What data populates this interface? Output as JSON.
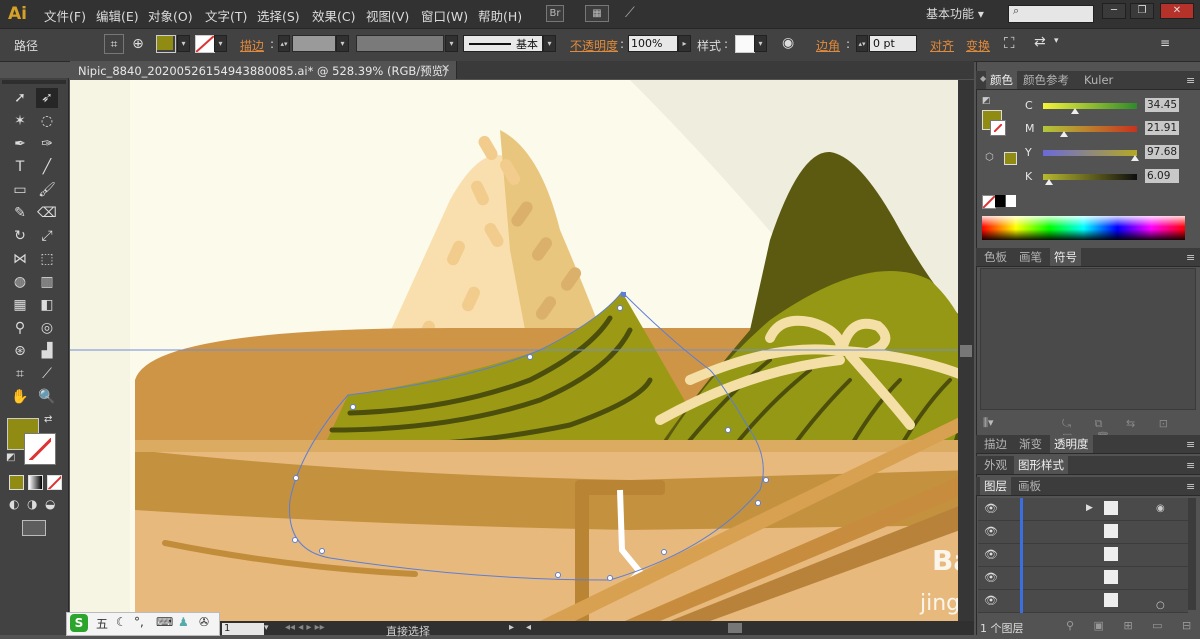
{
  "app": {
    "logo": "Ai"
  },
  "menu": [
    "文件(F)",
    "编辑(E)",
    "对象(O)",
    "文字(T)",
    "选择(S)",
    "效果(C)",
    "视图(V)",
    "窗口(W)",
    "帮助(H)"
  ],
  "menubar_icons": {
    "bridge": "Br"
  },
  "workspace": {
    "label": "基本功能",
    "arrow": "▾"
  },
  "window_buttons": [
    "─",
    "❐",
    "✕"
  ],
  "control_bar": {
    "selection_label": "路径",
    "fill_color": "#8f8b13",
    "stroke_label": "描边",
    "stroke_style": "基本",
    "opacity_label": "不透明度",
    "opacity_value": "100%",
    "style_label": "样式",
    "corner_label": "边角",
    "corner_value": "0 pt",
    "align_label": "对齐",
    "transform_label": "变换"
  },
  "document": {
    "tab_title": "Nipic_8840_20200526154943880085.ai* @ 528.39% (RGB/预览)",
    "close": "✕"
  },
  "toolbar": {
    "fill_color": "#8f8b13"
  },
  "color_panel": {
    "tabs": [
      "颜色",
      "颜色参考",
      "Kuler"
    ],
    "channels": [
      {
        "label": "C",
        "value": "34.45",
        "percent": 34.45,
        "gradient": "linear-gradient(90deg,#f6f13a,#2f8a2a)"
      },
      {
        "label": "M",
        "value": "21.91",
        "percent": 21.91,
        "gradient": "linear-gradient(90deg,#b0c83a,#c8321e)"
      },
      {
        "label": "Y",
        "value": "97.68",
        "percent": 97.68,
        "gradient": "linear-gradient(90deg,#6a6ad8,#b4a824)"
      },
      {
        "label": "K",
        "value": "6.09",
        "percent": 6.09,
        "gradient": "linear-gradient(90deg,#b8b830,#0e0e0e)"
      }
    ]
  },
  "swatch_panel": {
    "tabs": [
      "色板",
      "画笔",
      "符号"
    ]
  },
  "stroke_panel": {
    "tabs": [
      "描边",
      "渐变",
      "透明度"
    ]
  },
  "appearance_panel": {
    "tabs": [
      "外观",
      "图形样式"
    ]
  },
  "layers_panel": {
    "tabs": [
      "图层",
      "画板"
    ],
    "footer": "1 个图层"
  },
  "statusbar": {
    "zoom": "1",
    "text": "直接选择"
  },
  "ime": {
    "mode": "五"
  },
  "watermark": "Baidu jingyan.baidu"
}
